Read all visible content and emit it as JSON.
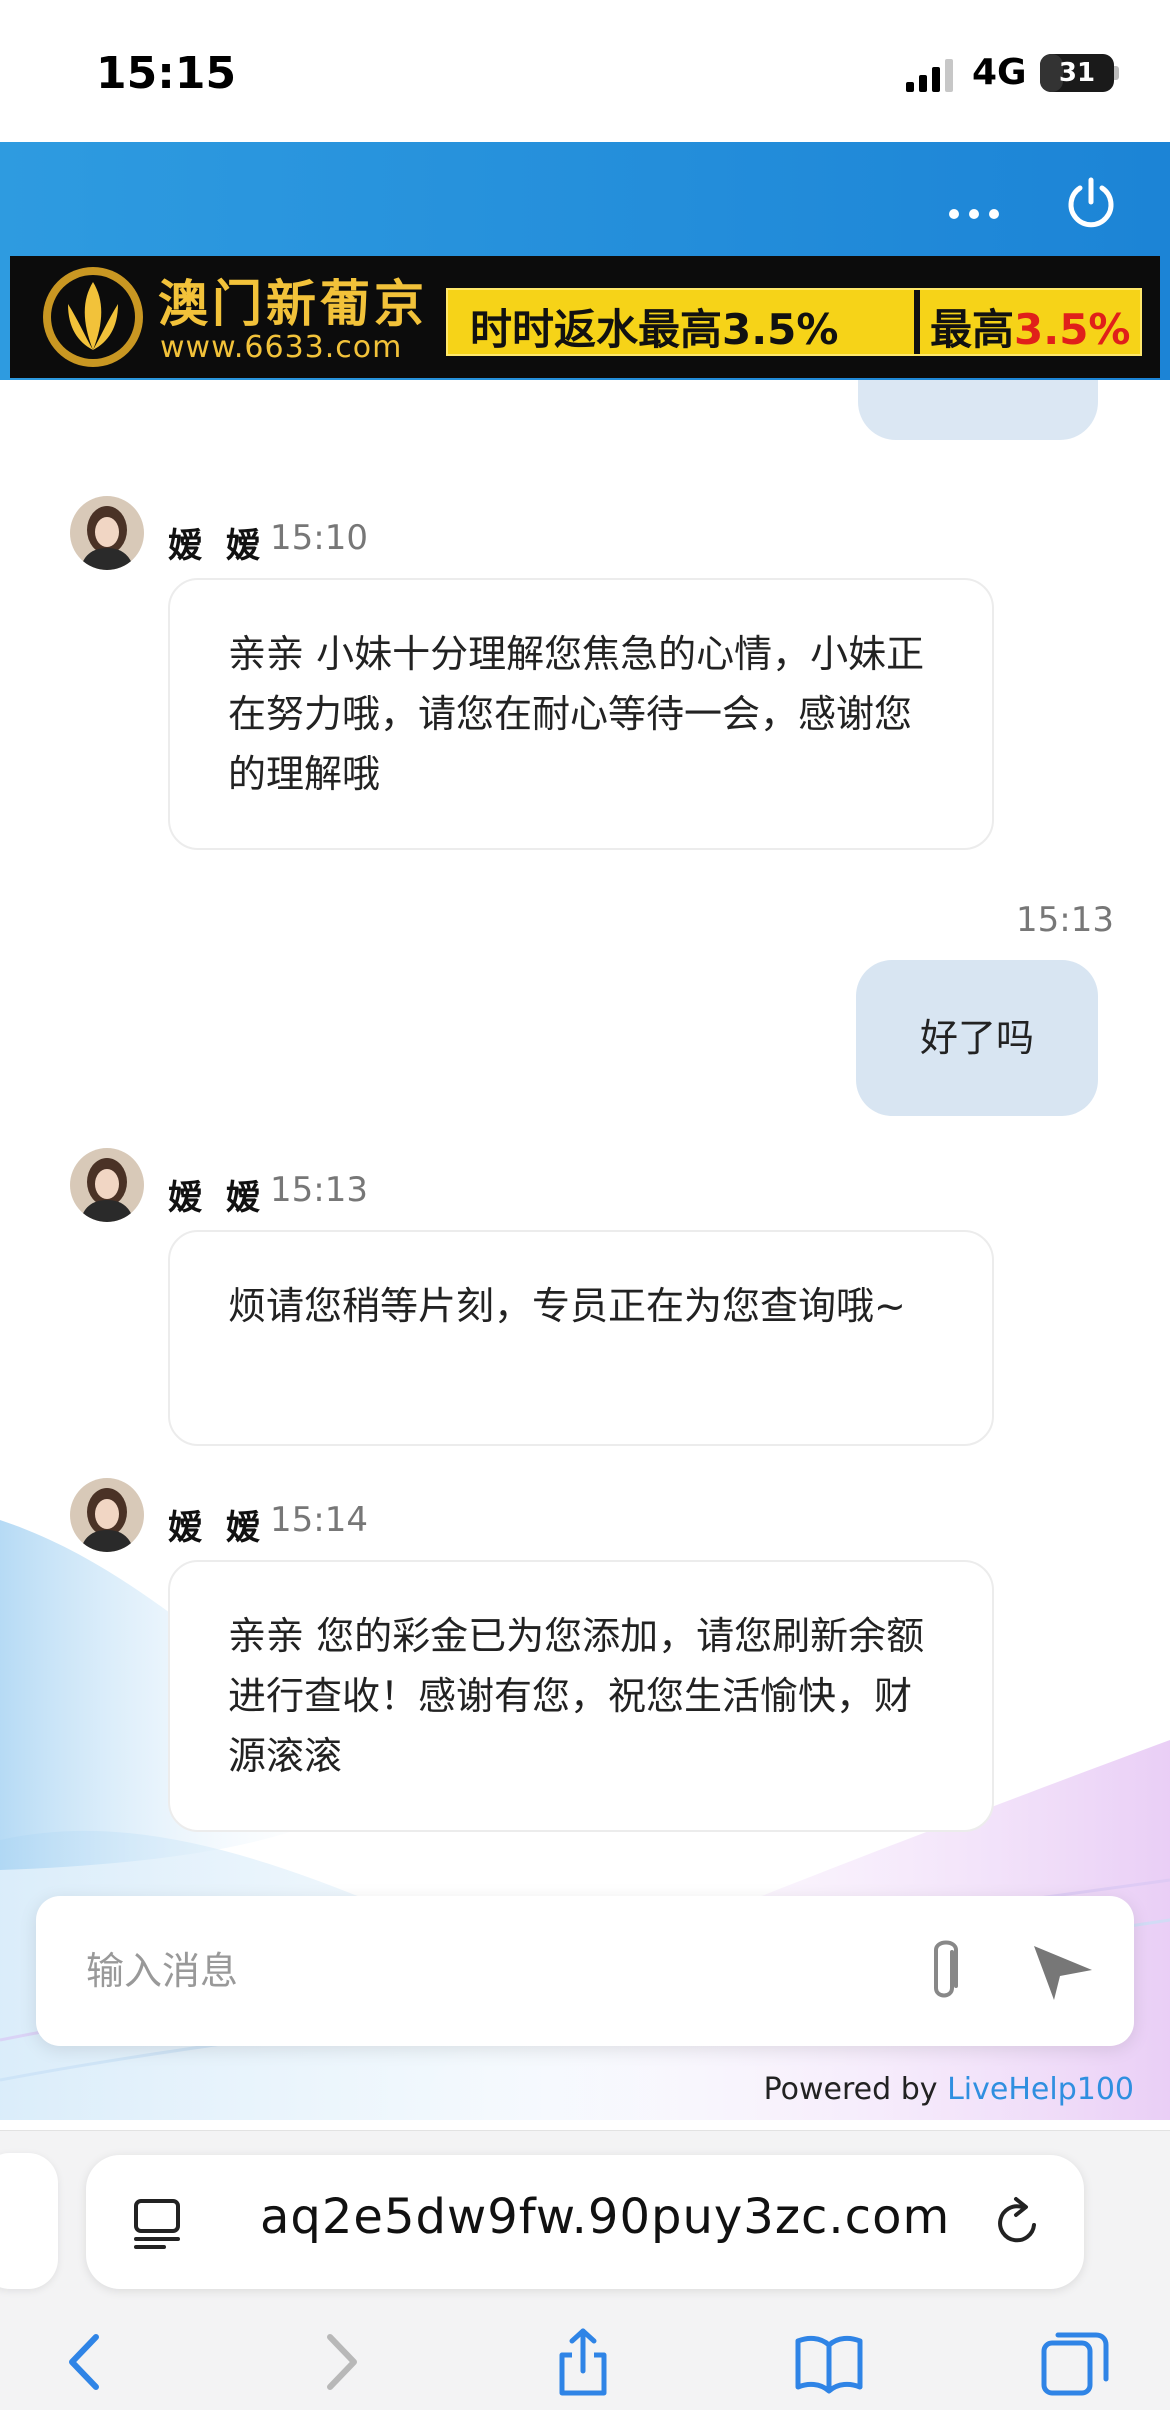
{
  "status_bar": {
    "time": "15:15",
    "network": "4G",
    "battery": "31",
    "battery_level": 0.31
  },
  "header": {
    "more_icon": "more-dots-icon",
    "power_icon": "power-icon",
    "banner": {
      "brand": "澳门新葡京",
      "url": "www.6633.com",
      "slogan": "时时返水最高3.5%",
      "slogan_right_prefix": "最高",
      "slogan_right_value": "3.5%"
    }
  },
  "messages": [
    {
      "direction": "in",
      "sender": "嫒 嫒",
      "time": "15:10",
      "text": "亲亲 小妹十分理解您焦急的心情，小妹正在努力哦，请您在耐心等待一会，感谢您的理解哦"
    },
    {
      "direction": "out",
      "time": "15:13",
      "text": "好了吗"
    },
    {
      "direction": "in",
      "sender": "嫒 嫒",
      "time": "15:13",
      "text": "烦请您稍等片刻，专员正在为您查询哦~"
    },
    {
      "direction": "in",
      "sender": "嫒 嫒",
      "time": "15:14",
      "text": "亲亲 您的彩金已为您添加，请您刷新余额进行查收！感谢有您，祝您生活愉快，财源滚滚"
    }
  ],
  "composer": {
    "placeholder": "输入消息",
    "attach_icon": "paperclip-icon",
    "send_icon": "send-icon"
  },
  "footer": {
    "powered_prefix": "Powered by",
    "powered_link": "LiveHelp100"
  },
  "browser": {
    "url": "aq2e5dw9fw.90puy3zc.com",
    "icons": [
      "reader-icon",
      "reload-icon",
      "back-icon",
      "forward-icon",
      "share-icon",
      "bookmarks-icon",
      "tabs-icon"
    ]
  },
  "colors": {
    "header_blue": "#1c84d6",
    "outgoing_bubble": "#d8e5f2",
    "link_blue": "#2f8fe0",
    "banner_gold": "#f2c23a",
    "banner_yellow": "#f6d318"
  }
}
